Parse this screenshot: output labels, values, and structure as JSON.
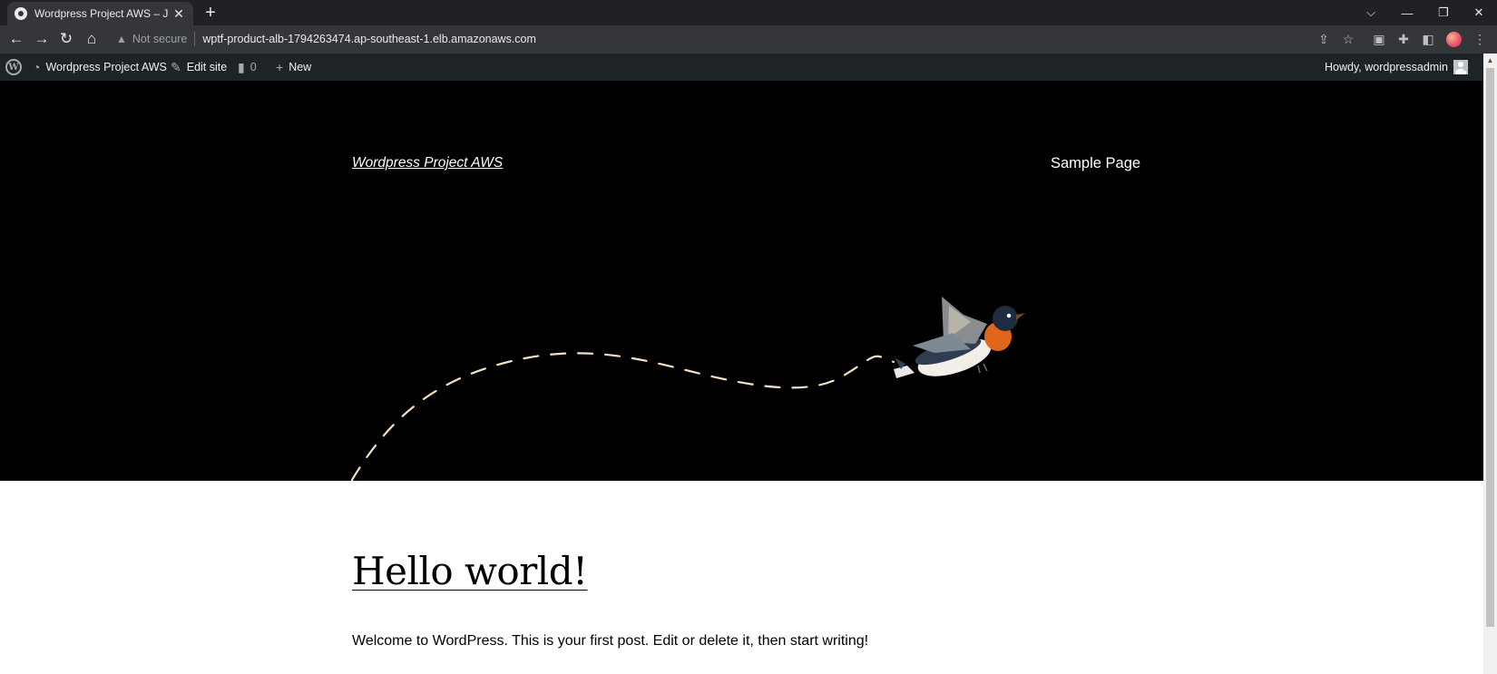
{
  "browser": {
    "tab_title": "Wordpress Project AWS – Just an",
    "not_secure": "Not secure",
    "url": "wptf-product-alb-1794263474.ap-southeast-1.elb.amazonaws.com"
  },
  "adminbar": {
    "site_name": "Wordpress Project AWS",
    "edit_site": "Edit site",
    "comments_count": "0",
    "new_label": "New",
    "howdy": "Howdy, wordpressadmin"
  },
  "header": {
    "site_title": "Wordpress Project AWS",
    "nav": [
      "Sample Page"
    ]
  },
  "post": {
    "title": "Hello world!",
    "excerpt": "Welcome to WordPress. This is your first post. Edit or delete it, then start writing!"
  },
  "colors": {
    "hero_bg": "#000000",
    "adminbar_bg": "#1d2327",
    "path_stroke": "#f4e1c1"
  }
}
